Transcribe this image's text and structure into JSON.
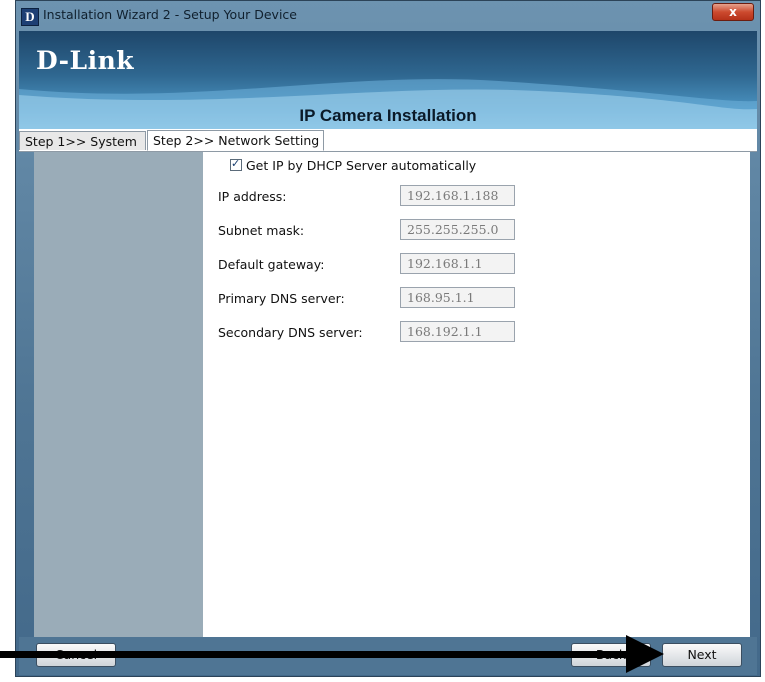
{
  "window": {
    "title": "Installation Wizard 2 - Setup Your Device",
    "icon_letter": "D",
    "close_label": "x"
  },
  "banner": {
    "logo": "D-Link",
    "title": "IP Camera Installation"
  },
  "tabs": [
    {
      "label": "Step 1>> System",
      "active": false
    },
    {
      "label": "Step 2>> Network Setting",
      "active": true
    }
  ],
  "network": {
    "dhcp": {
      "label": "Get IP by DHCP Server automatically",
      "checked": true
    },
    "fields": [
      {
        "label": "IP address:",
        "value": "192.168.1.188"
      },
      {
        "label": "Subnet mask:",
        "value": "255.255.255.0"
      },
      {
        "label": "Default gateway:",
        "value": "192.168.1.1"
      },
      {
        "label": "Primary DNS server:",
        "value": "168.95.1.1"
      },
      {
        "label": "Secondary DNS server:",
        "value": "168.192.1.1"
      }
    ]
  },
  "buttons": {
    "cancel": "Cancel",
    "back": "Back",
    "next": "Next"
  },
  "colors": {
    "banner": "#2f6790",
    "frame": "#4f7594",
    "left_panel": "#9aacb8",
    "close": "#cc4a2e",
    "arrow": "#000000"
  }
}
